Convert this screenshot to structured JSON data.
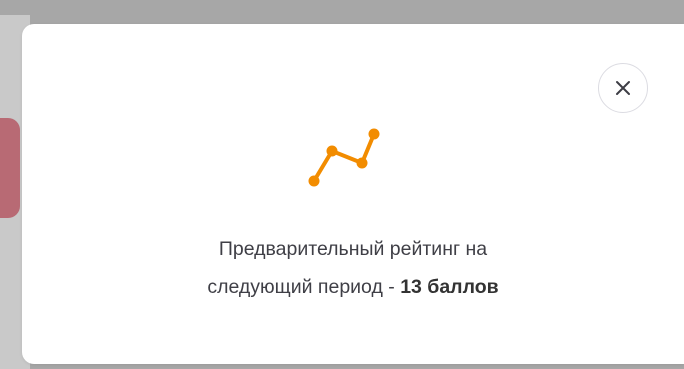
{
  "modal": {
    "icon": "trend-line-icon",
    "accent_color": "#f28c00",
    "message_line1": "Предварительный рейтинг на",
    "message_line2_prefix": "следующий период - ",
    "message_value": "13 баллов"
  },
  "close_button": {
    "icon": "close-icon"
  }
}
